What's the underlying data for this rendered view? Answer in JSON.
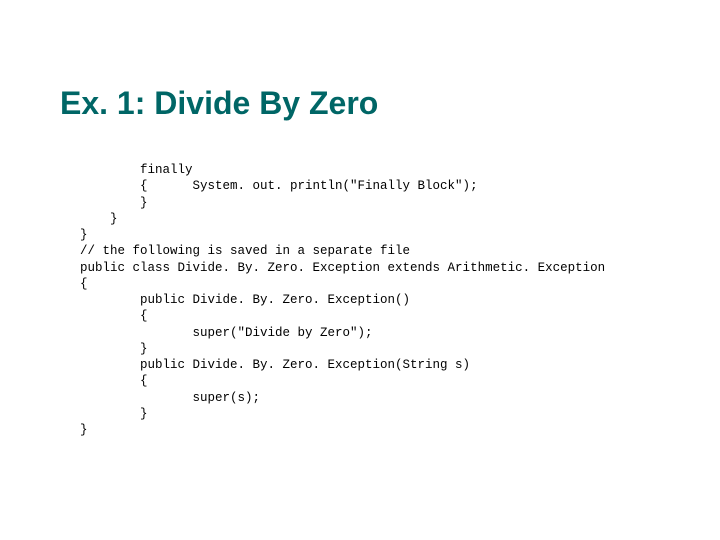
{
  "slide": {
    "title": "Ex. 1: Divide By Zero",
    "code": "        finally\n        {      System. out. println(\"Finally Block\");\n        }\n    }\n}\n// the following is saved in a separate file\npublic class Divide. By. Zero. Exception extends Arithmetic. Exception\n{\n        public Divide. By. Zero. Exception()\n        {\n               super(\"Divide by Zero\");\n        }\n        public Divide. By. Zero. Exception(String s)\n        {\n               super(s);\n        }\n}"
  }
}
